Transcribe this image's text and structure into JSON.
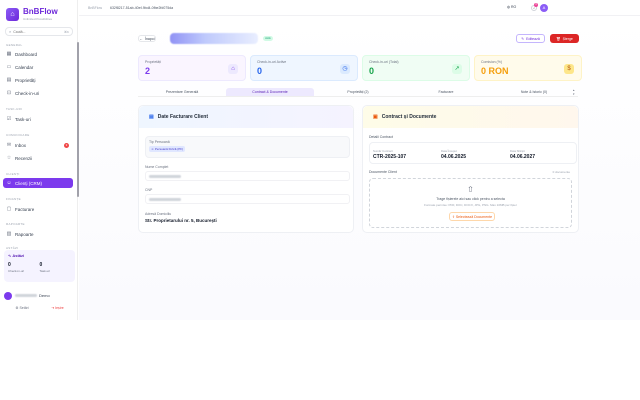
{
  "brand": {
    "name": "BnBFlow",
    "subtitle": "Unlimited Possibilities"
  },
  "search": {
    "placeholder": "Caută...",
    "shortcut": "⌘K"
  },
  "nav": {
    "general": "GENERAL",
    "dashboard": "Dashboard",
    "calendar": "Calendar",
    "properties": "Proprietăți",
    "checkin": "Check-in-uri",
    "ops": "TASK-URI",
    "tasks": "Task-uri",
    "comm": "COMUNICARE",
    "inbox": "Inbox",
    "inbox_count": "3",
    "reviews": "Recenzii",
    "clients": "CLIENȚI",
    "crm": "Clienți (CRM)",
    "finance": "FINANȚE",
    "invoices": "Facturare",
    "reports_section": "RAPOARTE",
    "reports": "Rapoarte",
    "activity_section": "ASTĂZI"
  },
  "activity": {
    "title": "Astăzi",
    "checkin_value": "0",
    "checkin_label": "Check-in-uri",
    "checkout_value": "0",
    "checkout_label": "Task-uri"
  },
  "user": {
    "name": "Demo",
    "settings": "Setări",
    "logout": "Ieșire"
  },
  "topbar": {
    "crumb": "BnBFlow",
    "record_id": "632f8217-51ab-40ef-9bd4-0fbe2fd075da",
    "lang": "RO",
    "notif_count": "3",
    "avatar": "A"
  },
  "header": {
    "back": "Înapoi",
    "status": "Activ",
    "edit": "Editează",
    "delete": "Șterge"
  },
  "stats": [
    {
      "label": "Proprietăți",
      "value": "2",
      "icon": "home-icon"
    },
    {
      "label": "Check-in-uri Active",
      "value": "0",
      "icon": "clock-icon"
    },
    {
      "label": "Check-in-uri (Total)",
      "value": "0",
      "icon": "trend-icon"
    },
    {
      "label": "Comision (%)",
      "value": "0 RON",
      "icon": "dollar-icon"
    }
  ],
  "colors": {
    "accent": "#7c3aed",
    "danger": "#dc2626",
    "blue": "#2563eb",
    "green": "#16a34a",
    "amber": "#f59e0b"
  },
  "tabs": [
    "Prezentare Generală",
    "Contract & Documente",
    "Proprietăți (2)",
    "Facturare",
    "Note & Istoric (0)"
  ],
  "invoice": {
    "title": "Date Facturare Client",
    "person_type_label": "Tip Persoană",
    "person_type_value": "Persoană Fizică (PF)",
    "name_label": "Nume Complet",
    "cnp_label": "CNP",
    "address_label": "Adresă Domiciliu",
    "address_value": "Str. Proprietarului nr. 5, București"
  },
  "contract": {
    "title": "Contract și Documente",
    "details_label": "Detalii Contract",
    "number_label": "Număr Contract",
    "number_value": "CTR-2025-107",
    "start_label": "Data Început",
    "start_value": "04.06.2025",
    "end_label": "Data Sfârșit",
    "end_value": "04.06.2027",
    "docs_label": "Documente Client",
    "docs_count": "0 documente",
    "drop_main": "Trage fișierele aici sau click pentru a selecta",
    "drop_sub": "Formate permise: PDF, DOC, DOCX, JPG, PNG. Max 10MB per fișier",
    "select_btn": "Selectează Documente"
  }
}
